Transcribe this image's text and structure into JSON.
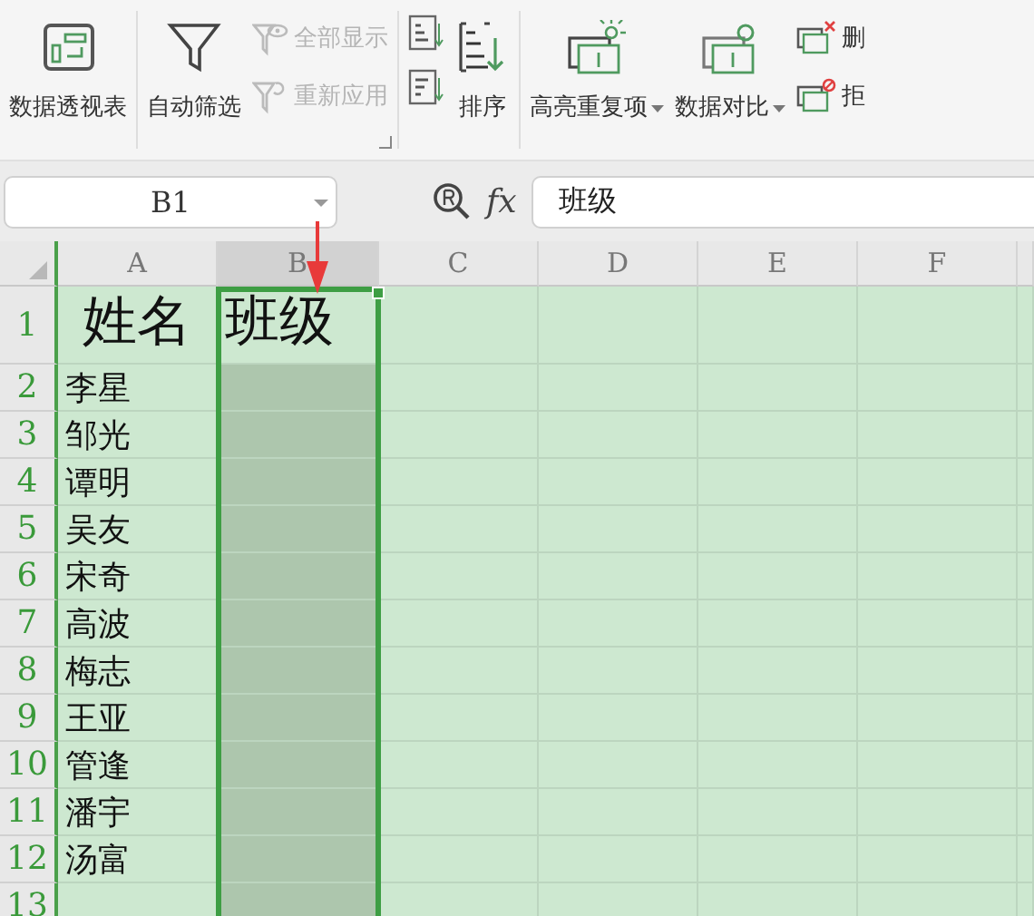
{
  "ribbon": {
    "groups": [
      {
        "items": [
          {
            "kind": "large",
            "label": "数据透视表"
          }
        ]
      },
      {
        "dialog_launcher": true,
        "items": [
          {
            "kind": "large",
            "label": "自动筛选"
          },
          {
            "kind": "small",
            "label": "全部显示",
            "disabled": true
          },
          {
            "kind": "small",
            "label": "重新应用",
            "disabled": true
          }
        ]
      },
      {
        "items": [
          {
            "kind": "icon-pair"
          },
          {
            "kind": "large",
            "label": "排序"
          }
        ]
      },
      {
        "items": [
          {
            "kind": "large",
            "label": "高亮重复项",
            "dropdown": true
          },
          {
            "kind": "large",
            "label": "数据对比",
            "dropdown": true
          },
          {
            "kind": "small",
            "label": "删",
            "disabled": false
          },
          {
            "kind": "small",
            "label": "拒",
            "disabled": false
          }
        ]
      }
    ]
  },
  "formula_bar": {
    "name_box": "B1",
    "fx_label": "fx",
    "value": "班级"
  },
  "sheet": {
    "columns": [
      {
        "label": "A",
        "selected": false
      },
      {
        "label": "B",
        "selected": true
      },
      {
        "label": "C",
        "selected": false
      },
      {
        "label": "D",
        "selected": false
      },
      {
        "label": "E",
        "selected": false
      },
      {
        "label": "F",
        "selected": false
      }
    ],
    "rows": [
      {
        "header": "1",
        "cells": [
          "姓名",
          "班级"
        ]
      },
      {
        "header": "2",
        "cells": [
          "李星",
          ""
        ]
      },
      {
        "header": "3",
        "cells": [
          "邹光",
          ""
        ]
      },
      {
        "header": "4",
        "cells": [
          "谭明",
          ""
        ]
      },
      {
        "header": "5",
        "cells": [
          "吴友",
          ""
        ]
      },
      {
        "header": "6",
        "cells": [
          "宋奇",
          ""
        ]
      },
      {
        "header": "7",
        "cells": [
          "高波",
          ""
        ]
      },
      {
        "header": "8",
        "cells": [
          "梅志",
          ""
        ]
      },
      {
        "header": "9",
        "cells": [
          "王亚",
          ""
        ]
      },
      {
        "header": "10",
        "cells": [
          "管逢",
          ""
        ]
      },
      {
        "header": "11",
        "cells": [
          "潘宇",
          ""
        ]
      },
      {
        "header": "12",
        "cells": [
          "汤富",
          ""
        ]
      },
      {
        "header": "13",
        "cells": [
          "",
          ""
        ]
      }
    ]
  }
}
